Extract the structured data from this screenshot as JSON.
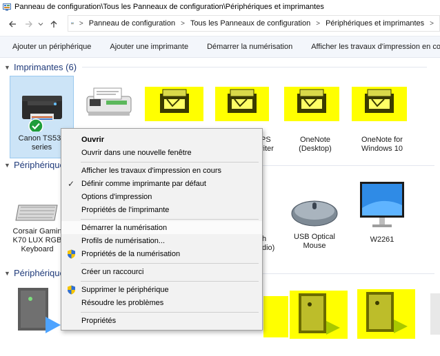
{
  "window": {
    "title": "Panneau de configuration\\Tous les Panneaux de configuration\\Périphériques et imprimantes"
  },
  "address": {
    "crumbs": [
      "Panneau de configuration",
      "Tous les Panneaux de configuration",
      "Périphériques et imprimantes"
    ]
  },
  "toolbar": {
    "add_device": "Ajouter un périphérique",
    "add_printer": "Ajouter une imprimante",
    "start_scan": "Démarrer la numérisation",
    "see_print_jobs": "Afficher les travaux d'impression en cours"
  },
  "groups": {
    "printers": {
      "title": "Imprimantes (6)"
    },
    "devices": {
      "title": "Périphériques"
    },
    "multimedia": {
      "title": "Périphériques"
    }
  },
  "printers": [
    {
      "name": "Canon TS530 series"
    },
    {
      "name": ""
    },
    {
      "name": ""
    },
    {
      "name": "PS",
      "line2": "riter"
    },
    {
      "name": "OneNote",
      "line2": "(Desktop)"
    },
    {
      "name": "OneNote for",
      "line2": "Windows 10"
    }
  ],
  "devices": [
    {
      "name": "Corsair Gamin",
      "line2": "K70 LUX RGB",
      "line3": "Keyboard"
    },
    {
      "name": "h",
      "line2": "dio)"
    },
    {
      "name": "USB Optical",
      "line2": "Mouse"
    },
    {
      "name": "W2261"
    }
  ],
  "context_menu": {
    "items": [
      {
        "label": "Ouvrir",
        "bold": true
      },
      {
        "label": "Ouvrir dans une nouvelle fenêtre"
      },
      {
        "label": "Afficher les travaux d'impression en cours"
      },
      {
        "label": "Définir comme imprimante par défaut",
        "checked": true
      },
      {
        "label": "Options d'impression"
      },
      {
        "label": "Propriétés de l'imprimante"
      },
      {
        "label": "Démarrer la numérisation",
        "hover": true
      },
      {
        "label": "Profils de numérisation..."
      },
      {
        "label": "Propriétés de la numérisation",
        "shield": true
      },
      {
        "label": "Créer un raccourci"
      },
      {
        "label": "Supprimer le périphérique",
        "shield": true
      },
      {
        "label": "Résoudre les problèmes"
      },
      {
        "label": "Propriétés"
      }
    ]
  },
  "colors": {
    "highlight": "#ffff00",
    "accent": "#1f3a7a",
    "selection": "#cce4f7",
    "check": "#16a34a"
  }
}
